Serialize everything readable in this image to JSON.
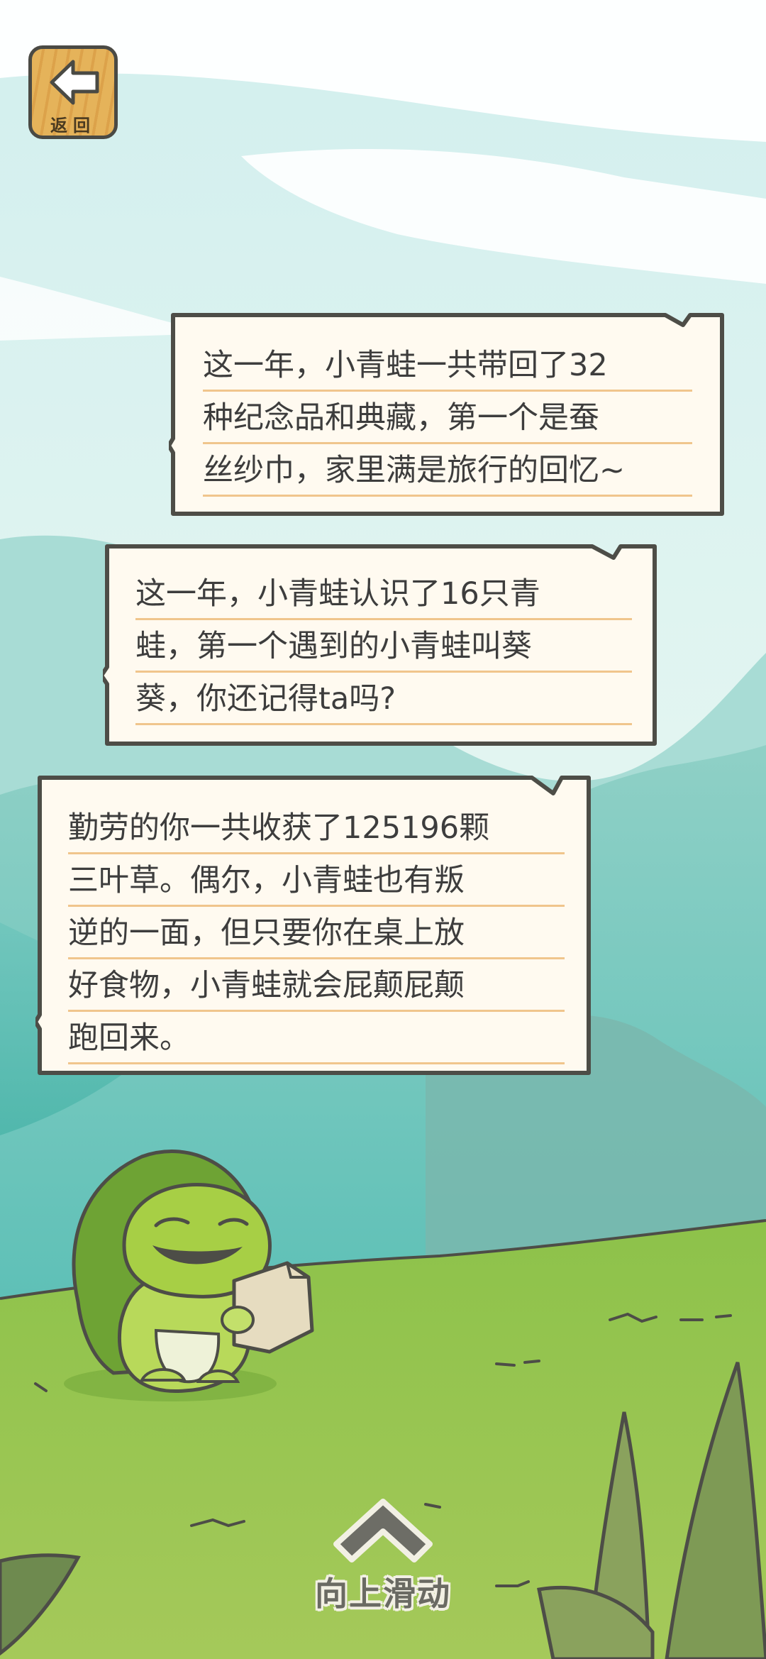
{
  "back_button": {
    "label": "返回",
    "icon": "arrow-left-icon"
  },
  "bubbles": [
    {
      "lines": [
        "这一年，小青蛙一共带回了32",
        "种纪念品和典藏，第一个是蚕",
        "丝纱巾，家里满是旅行的回忆~"
      ]
    },
    {
      "lines": [
        "这一年，小青蛙认识了16只青",
        "蛙，第一个遇到的小青蛙叫葵",
        "葵，你还记得ta吗?"
      ]
    },
    {
      "lines": [
        "勤劳的你一共收获了125196颗",
        "三叶草。偶尔，小青蛙也有叛",
        "逆的一面，但只要你在桌上放",
        "好食物，小青蛙就会屁颠屁颠",
        "跑回来。"
      ]
    }
  ],
  "swipe_hint": {
    "label": "向上滑动",
    "icon": "chevron-up-icon"
  },
  "colors": {
    "sky": "#dff3ee",
    "bubble_fill": "#fffaf0",
    "bubble_border": "#4d4d47",
    "underline": "#f0c58c",
    "grass": "#8fbf4a",
    "frog": "#9cc93a"
  }
}
